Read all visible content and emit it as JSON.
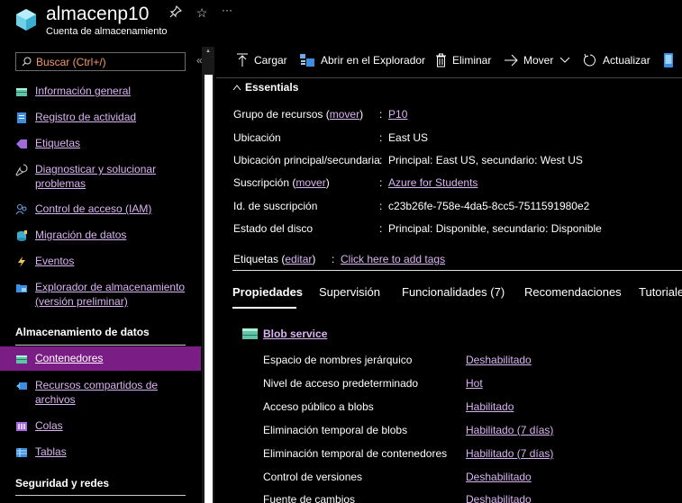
{
  "header": {
    "title": "almacenp10",
    "subtitle": "Cuenta de almacenamiento",
    "pin_glyph": "⊹",
    "star_glyph": "☆",
    "more_glyph": "···"
  },
  "sidebar": {
    "search_placeholder": "Buscar (Ctrl+/)",
    "collapse_glyph": "«",
    "items": [
      {
        "label": "Información general",
        "icon": "overview-icon"
      },
      {
        "label": "Registro de actividad",
        "icon": "activity-log-icon"
      },
      {
        "label": "Etiquetas",
        "icon": "tag-icon"
      },
      {
        "label": "Diagnosticar y solucionar problemas",
        "icon": "wrench-icon"
      },
      {
        "label": "Control de acceso (IAM)",
        "icon": "people-icon"
      },
      {
        "label": "Migración de datos",
        "icon": "migration-icon"
      },
      {
        "label": "Eventos",
        "icon": "lightning-icon"
      },
      {
        "label": "Explorador de almacenamiento (versión preliminar)",
        "icon": "folder-icon"
      }
    ],
    "section_data_storage": "Almacenamiento de datos",
    "data_items": [
      {
        "label": "Contenedores",
        "icon": "container-icon",
        "active": true
      },
      {
        "label": "Recursos compartidos de archivos",
        "icon": "fileshare-icon"
      },
      {
        "label": "Colas",
        "icon": "queue-icon"
      },
      {
        "label": "Tablas",
        "icon": "table-icon"
      }
    ],
    "section_security": "Seguridad y redes"
  },
  "toolbar": {
    "upload": "Cargar",
    "open_explorer": "Abrir en el Explorador",
    "delete": "Eliminar",
    "move": "Mover",
    "refresh": "Actualizar"
  },
  "essentials": {
    "header": "Essentials",
    "rows": [
      {
        "label_pre": "Grupo de recursos (",
        "label_link": "mover",
        "label_post": ")",
        "value": "P10",
        "value_link": true
      },
      {
        "label": "Ubicación",
        "value": "East US"
      },
      {
        "label": "Ubicación principal/secundaria",
        "value": "Principal: East US, secundario: West US"
      },
      {
        "label_pre": "Suscripción (",
        "label_link": "mover",
        "label_post": ")",
        "value": "Azure for Students",
        "value_link": true
      },
      {
        "label": "Id. de suscripción",
        "value": "c23b26fe-758e-4da5-8cc5-7511591980e2"
      },
      {
        "label": "Estado del disco",
        "value": "Principal: Disponible, secundario: Disponible"
      }
    ],
    "tags_pre": "Etiquetas (",
    "tags_link": "editar",
    "tags_post": ")",
    "tags_value": "Click here to add tags"
  },
  "tabs": [
    "Propiedades",
    "Supervisión",
    "Funcionalidades (7)",
    "Recomendaciones",
    "Tutoriales"
  ],
  "properties": {
    "section": "Blob service",
    "rows": [
      {
        "label": "Espacio de nombres jerárquico",
        "value": "Deshabilitado"
      },
      {
        "label": "Nivel de acceso predeterminado",
        "value": "Hot"
      },
      {
        "label": "Acceso público a blobs",
        "value": "Habilitado"
      },
      {
        "label": "Eliminación temporal de blobs",
        "value": "Habilitado (7 días)"
      },
      {
        "label": "Eliminación temporal de contenedores",
        "value": "Habilitado (7 días)"
      },
      {
        "label": "Control de versiones",
        "value": "Deshabilitado"
      },
      {
        "label": "Fuente de cambios",
        "value": "Deshabilitado"
      }
    ]
  },
  "colors": {
    "accent": "#7a1d85",
    "link": "#dab4f2",
    "search_text": "#f59a6a"
  }
}
